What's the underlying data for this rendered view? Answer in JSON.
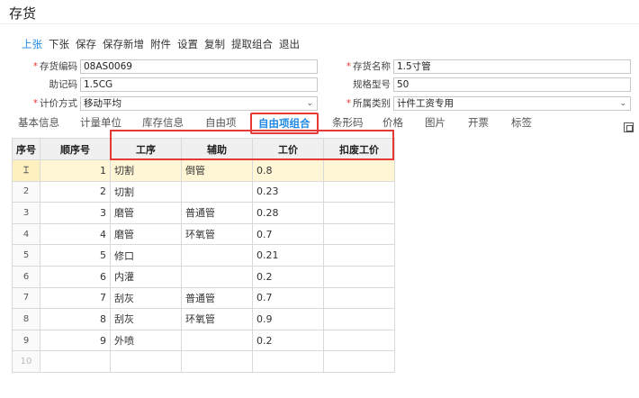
{
  "page": {
    "title": "存货"
  },
  "toolbar": {
    "buttons": [
      "上张",
      "下张",
      "保存",
      "保存新增",
      "附件",
      "设置",
      "复制",
      "提取组合",
      "退出"
    ]
  },
  "form": {
    "code": {
      "label": "存货编码",
      "value": "08AS0069"
    },
    "name": {
      "label": "存货名称",
      "value": "1.5寸管"
    },
    "memo": {
      "label": "助记码",
      "value": "1.5CG"
    },
    "spec": {
      "label": "规格型号",
      "value": "50"
    },
    "costing": {
      "label": "计价方式",
      "value": "移动平均"
    },
    "category": {
      "label": "所属类别",
      "value": "计件工资专用"
    }
  },
  "tabs": [
    "基本信息",
    "计量单位",
    "库存信息",
    "自由项",
    "自由项组合",
    "条形码",
    "价格",
    "图片",
    "开票",
    "标签"
  ],
  "active_tab": "自由项组合",
  "grid": {
    "columns": [
      "序号",
      "顺序号",
      "工序",
      "辅助",
      "工价",
      "扣废工价"
    ],
    "selected_marker": "⌶",
    "rows": [
      {
        "no": "1",
        "seq": "1",
        "process": "切割",
        "aux": "倒管",
        "price": "0.8",
        "scrap": ""
      },
      {
        "no": "2",
        "seq": "2",
        "process": "切割",
        "aux": "",
        "price": "0.23",
        "scrap": ""
      },
      {
        "no": "3",
        "seq": "3",
        "process": "磨管",
        "aux": "普通管",
        "price": "0.28",
        "scrap": ""
      },
      {
        "no": "4",
        "seq": "4",
        "process": "磨管",
        "aux": "环氧管",
        "price": "0.7",
        "scrap": ""
      },
      {
        "no": "5",
        "seq": "5",
        "process": "修口",
        "aux": "",
        "price": "0.21",
        "scrap": ""
      },
      {
        "no": "6",
        "seq": "6",
        "process": "内灌",
        "aux": "",
        "price": "0.2",
        "scrap": ""
      },
      {
        "no": "7",
        "seq": "7",
        "process": "刮灰",
        "aux": "普通管",
        "price": "0.7",
        "scrap": ""
      },
      {
        "no": "8",
        "seq": "8",
        "process": "刮灰",
        "aux": "环氧管",
        "price": "0.9",
        "scrap": ""
      },
      {
        "no": "9",
        "seq": "9",
        "process": "外喷",
        "aux": "",
        "price": "0.2",
        "scrap": ""
      },
      {
        "no": "10",
        "seq": "",
        "process": "",
        "aux": "",
        "price": "",
        "scrap": ""
      }
    ]
  },
  "colors": {
    "accent": "#1e88e5",
    "highlight": "#e53935",
    "selected_row": "#fff6d6"
  }
}
